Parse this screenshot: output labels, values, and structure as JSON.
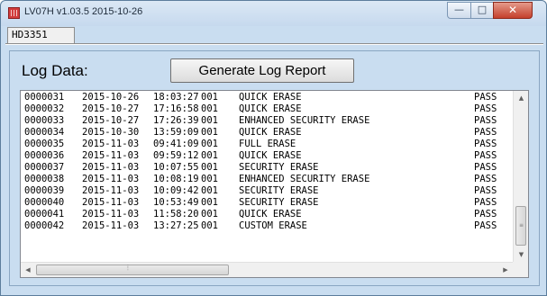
{
  "window": {
    "title": "LV07H v1.03.5 2015-10-26",
    "controls": {
      "minimize": "—",
      "maximize": "□",
      "close": "✕"
    }
  },
  "tabs": [
    {
      "label": "HD3351",
      "selected": true
    }
  ],
  "panel": {
    "label": "Log Data:",
    "generate_button": "Generate Log Report"
  },
  "log": {
    "rows": [
      {
        "id": "0000031",
        "date": "2015-10-26",
        "time": "18:03:27",
        "code": "001",
        "operation": "QUICK ERASE",
        "result": "PASS"
      },
      {
        "id": "0000032",
        "date": "2015-10-27",
        "time": "17:16:58",
        "code": "001",
        "operation": "QUICK ERASE",
        "result": "PASS"
      },
      {
        "id": "0000033",
        "date": "2015-10-27",
        "time": "17:26:39",
        "code": "001",
        "operation": "ENHANCED SECURITY ERASE",
        "result": "PASS"
      },
      {
        "id": "0000034",
        "date": "2015-10-30",
        "time": "13:59:09",
        "code": "001",
        "operation": "QUICK ERASE",
        "result": "PASS"
      },
      {
        "id": "0000035",
        "date": "2015-11-03",
        "time": "09:41:09",
        "code": "001",
        "operation": "FULL ERASE",
        "result": "PASS"
      },
      {
        "id": "0000036",
        "date": "2015-11-03",
        "time": "09:59:12",
        "code": "001",
        "operation": "QUICK ERASE",
        "result": "PASS"
      },
      {
        "id": "0000037",
        "date": "2015-11-03",
        "time": "10:07:55",
        "code": "001",
        "operation": "SECURITY ERASE",
        "result": "PASS"
      },
      {
        "id": "0000038",
        "date": "2015-11-03",
        "time": "10:08:19",
        "code": "001",
        "operation": "ENHANCED SECURITY ERASE",
        "result": "PASS"
      },
      {
        "id": "0000039",
        "date": "2015-11-03",
        "time": "10:09:42",
        "code": "001",
        "operation": "SECURITY ERASE",
        "result": "PASS"
      },
      {
        "id": "0000040",
        "date": "2015-11-03",
        "time": "10:53:49",
        "code": "001",
        "operation": "SECURITY ERASE",
        "result": "PASS"
      },
      {
        "id": "0000041",
        "date": "2015-11-03",
        "time": "11:58:20",
        "code": "001",
        "operation": "QUICK ERASE",
        "result": "PASS"
      },
      {
        "id": "0000042",
        "date": "2015-11-03",
        "time": "13:27:25",
        "code": "001",
        "operation": "CUSTOM ERASE",
        "result": "PASS"
      }
    ]
  },
  "scrollbars": {
    "up_icon": "scroll-up-icon",
    "down_icon": "scroll-down-icon",
    "left_icon": "scroll-left-icon",
    "right_icon": "scroll-right-icon"
  }
}
